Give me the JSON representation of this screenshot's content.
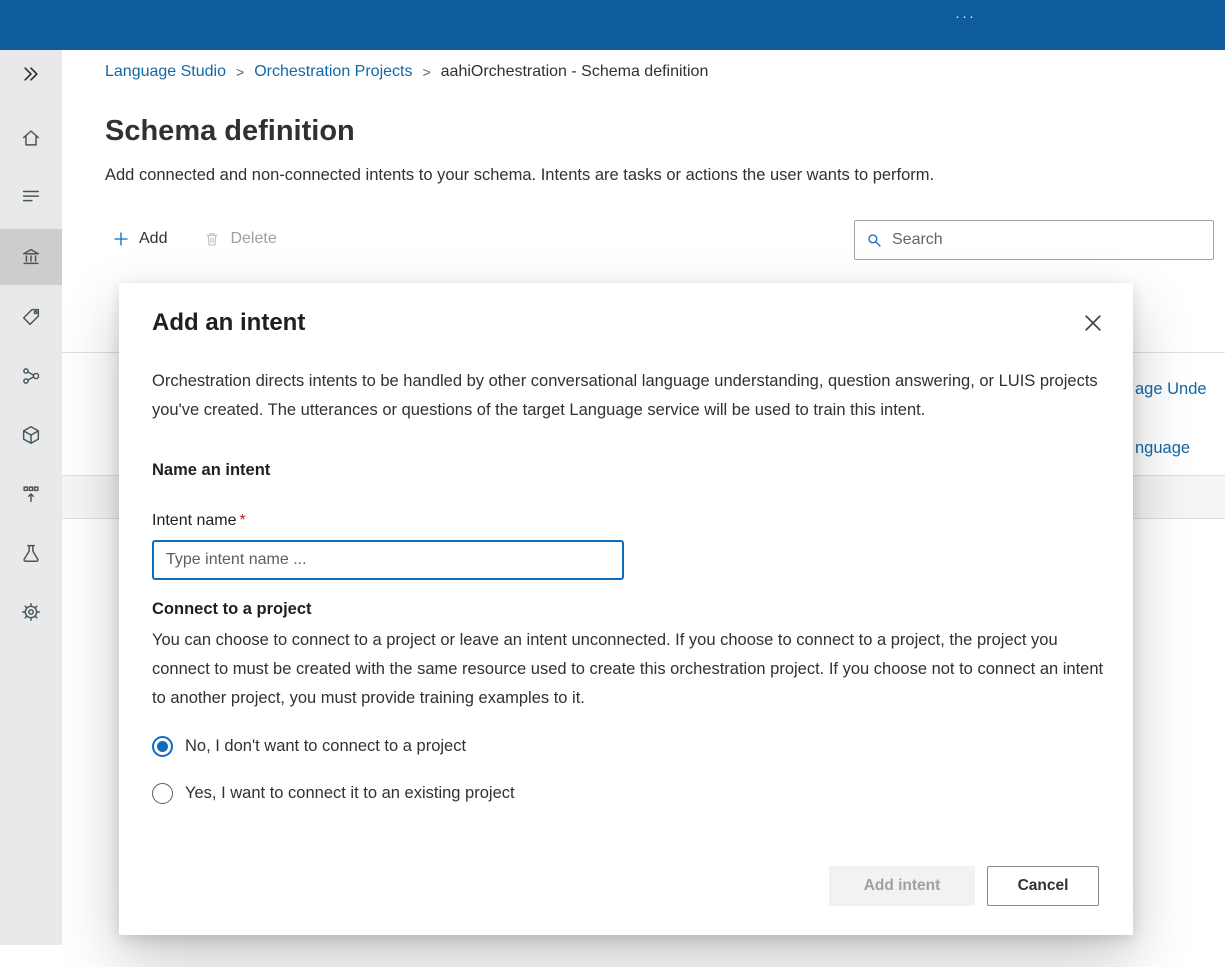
{
  "colors": {
    "topbar": "#0e5c9d",
    "accent": "#0f6cbd",
    "link": "#1168a7",
    "required": "#a4262c",
    "sidebar_bg": "#e9e9e9",
    "sidebar_active_bg": "#cdcdcd"
  },
  "topbar": {
    "overflow": "···"
  },
  "sidebar": {
    "items": [
      {
        "icon": "chevron-double-right"
      },
      {
        "icon": "home"
      },
      {
        "icon": "list"
      },
      {
        "icon": "building",
        "active": true
      },
      {
        "icon": "tag"
      },
      {
        "icon": "flow-nodes"
      },
      {
        "icon": "cube"
      },
      {
        "icon": "deploy"
      },
      {
        "icon": "flask"
      },
      {
        "icon": "gear"
      }
    ]
  },
  "breadcrumb": {
    "separator": ">",
    "items": [
      {
        "label": "Language Studio",
        "link": true
      },
      {
        "label": "Orchestration Projects",
        "link": true
      },
      {
        "label": "aahiOrchestration - Schema definition",
        "link": false
      }
    ]
  },
  "page": {
    "title": "Schema definition",
    "subtitle": "Add connected and non-connected intents to your schema. Intents are tasks or actions the user wants to perform."
  },
  "toolbar": {
    "add_label": "Add",
    "delete_label": "Delete",
    "search_placeholder": "Search"
  },
  "background_table": {
    "fragments": [
      {
        "text": "age Unde"
      },
      {
        "text": "nguage"
      }
    ]
  },
  "modal": {
    "title": "Add an intent",
    "description": "Orchestration directs intents to be handled by other conversational language understanding, question answering, or LUIS projects you've created. The utterances or questions of the target Language service will be used to train this intent.",
    "name_section": "Name an intent",
    "intent_label": "Intent name",
    "required_mark": "*",
    "input_placeholder": "Type intent name ...",
    "input_value": "",
    "connect_section": "Connect to a project",
    "connect_description": "You can choose to connect to a project or leave an intent unconnected. If you choose to connect to a project, the project you connect to must be created with the same resource used to create this orchestration project. If you choose not to connect an intent to another project, you must provide training examples to it.",
    "radio_options": [
      {
        "label": "No, I don't want to connect to a project",
        "selected": true
      },
      {
        "label": "Yes, I want to connect it to an existing project",
        "selected": false
      }
    ],
    "add_button": "Add intent",
    "cancel_button": "Cancel"
  }
}
